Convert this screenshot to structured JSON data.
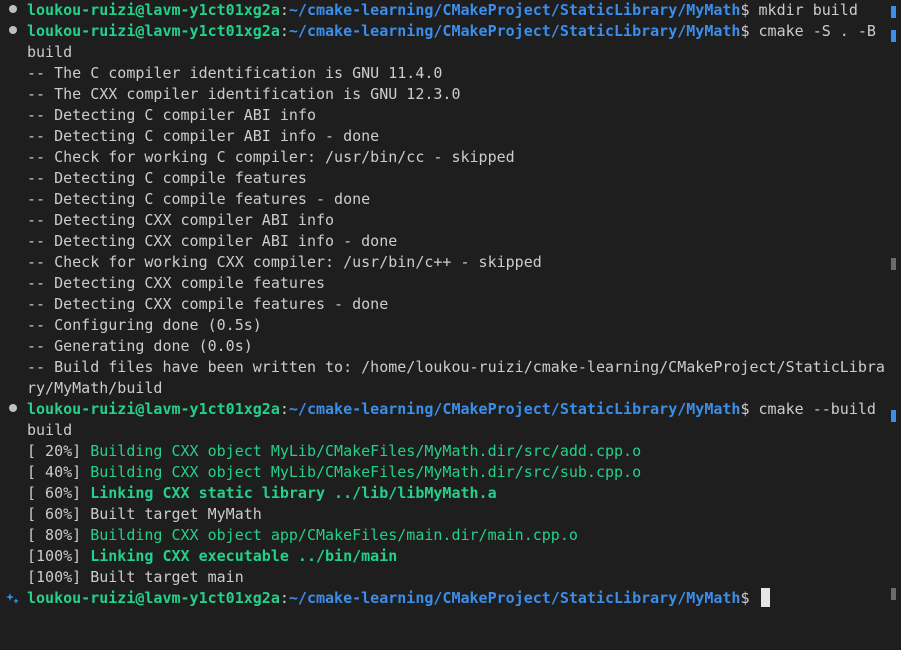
{
  "terminal": {
    "prompt_user": "loukou-ruizi@lavm-y1ct01xg2a",
    "prompt_sep": ":",
    "prompt_path": "~/cmake-learning/CMakeProject/StaticLibrary/MyMath",
    "prompt_end": "$",
    "lines": [
      {
        "kind": "prompt",
        "cmd": " mkdir build"
      },
      {
        "kind": "prompt",
        "cmd": " cmake -S . -B"
      },
      {
        "kind": "text",
        "text": "build"
      },
      {
        "kind": "text",
        "text": "-- The C compiler identification is GNU 11.4.0"
      },
      {
        "kind": "text",
        "text": "-- The CXX compiler identification is GNU 12.3.0"
      },
      {
        "kind": "text",
        "text": "-- Detecting C compiler ABI info"
      },
      {
        "kind": "text",
        "text": "-- Detecting C compiler ABI info - done"
      },
      {
        "kind": "text",
        "text": "-- Check for working C compiler: /usr/bin/cc - skipped"
      },
      {
        "kind": "text",
        "text": "-- Detecting C compile features"
      },
      {
        "kind": "text",
        "text": "-- Detecting C compile features - done"
      },
      {
        "kind": "text",
        "text": "-- Detecting CXX compiler ABI info"
      },
      {
        "kind": "text",
        "text": "-- Detecting CXX compiler ABI info - done"
      },
      {
        "kind": "text",
        "text": "-- Check for working CXX compiler: /usr/bin/c++ - skipped"
      },
      {
        "kind": "text",
        "text": "-- Detecting CXX compile features"
      },
      {
        "kind": "text",
        "text": "-- Detecting CXX compile features - done"
      },
      {
        "kind": "text",
        "text": "-- Configuring done (0.5s)"
      },
      {
        "kind": "text",
        "text": "-- Generating done (0.0s)"
      },
      {
        "kind": "text",
        "text": "-- Build files have been written to: /home/loukou-ruizi/cmake-learning/CMakeProject/StaticLibra"
      },
      {
        "kind": "text",
        "text": "ry/MyMath/build"
      },
      {
        "kind": "prompt",
        "cmd": " cmake --build"
      },
      {
        "kind": "text",
        "text": "build"
      },
      {
        "kind": "build",
        "prefix": "[ 20%] ",
        "text": "Building CXX object MyLib/CMakeFiles/MyMath.dir/src/add.cpp.o",
        "style": "green"
      },
      {
        "kind": "build",
        "prefix": "[ 40%] ",
        "text": "Building CXX object MyLib/CMakeFiles/MyMath.dir/src/sub.cpp.o",
        "style": "green"
      },
      {
        "kind": "build",
        "prefix": "[ 60%] ",
        "text": "Linking CXX static library ../lib/libMyMath.a",
        "style": "green-bold"
      },
      {
        "kind": "build",
        "prefix": "[ 60%] ",
        "text": "Built target MyMath",
        "style": "plain"
      },
      {
        "kind": "build",
        "prefix": "[ 80%] ",
        "text": "Building CXX object app/CMakeFiles/main.dir/main.cpp.o",
        "style": "green"
      },
      {
        "kind": "build",
        "prefix": "[100%] ",
        "text": "Linking CXX executable ../bin/main",
        "style": "green-bold"
      },
      {
        "kind": "build",
        "prefix": "[100%] ",
        "text": "Built target main",
        "style": "plain"
      },
      {
        "kind": "prompt-active",
        "cmd": " "
      }
    ]
  },
  "colors": {
    "background": "#1e1e1e",
    "user": "#23d18b",
    "path": "#3b8eea",
    "text": "#cccccc"
  },
  "icons": {
    "command_decoration": "circle-icon",
    "active_prompt_decoration": "sparkle-icon"
  }
}
